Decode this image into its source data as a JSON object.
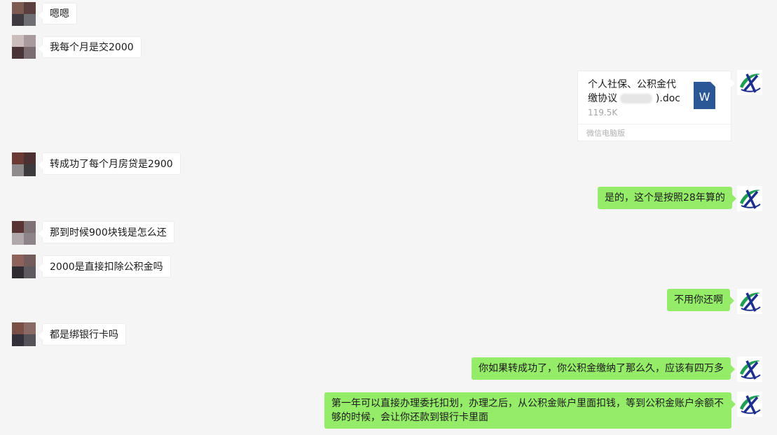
{
  "messages": {
    "m1": "嗯嗯",
    "m2": "我每个月是交2000",
    "m3": {
      "file_name_part1": "个人社保、公积金代",
      "file_name_part2": "缴协议",
      "file_name_suffix": ").doc",
      "file_size": "119.5K",
      "file_icon_letter": "W",
      "source": "微信电脑版"
    },
    "m4": "转成功了每个月房贷是2900",
    "m5": "是的，这个是按照28年算的",
    "m6": "那到时候900块钱是怎么还",
    "m7": "2000是直接扣除公积金吗",
    "m8": "不用你还啊",
    "m9": "都是绑银行卡吗",
    "m10": "你如果转成功了，你公积金缴纳了那么久，应该有四万多",
    "m11": "第一年可以直接办理委托扣划，办理之后，从公积金账户里面扣钱，等到公积金账户余额不够的时候，会让你还款到银行卡里面"
  },
  "colors": {
    "incoming_bubble": "#ffffff",
    "outgoing_bubble": "#95ec69",
    "background": "#f5f5f5",
    "word_icon": "#2b5797"
  }
}
